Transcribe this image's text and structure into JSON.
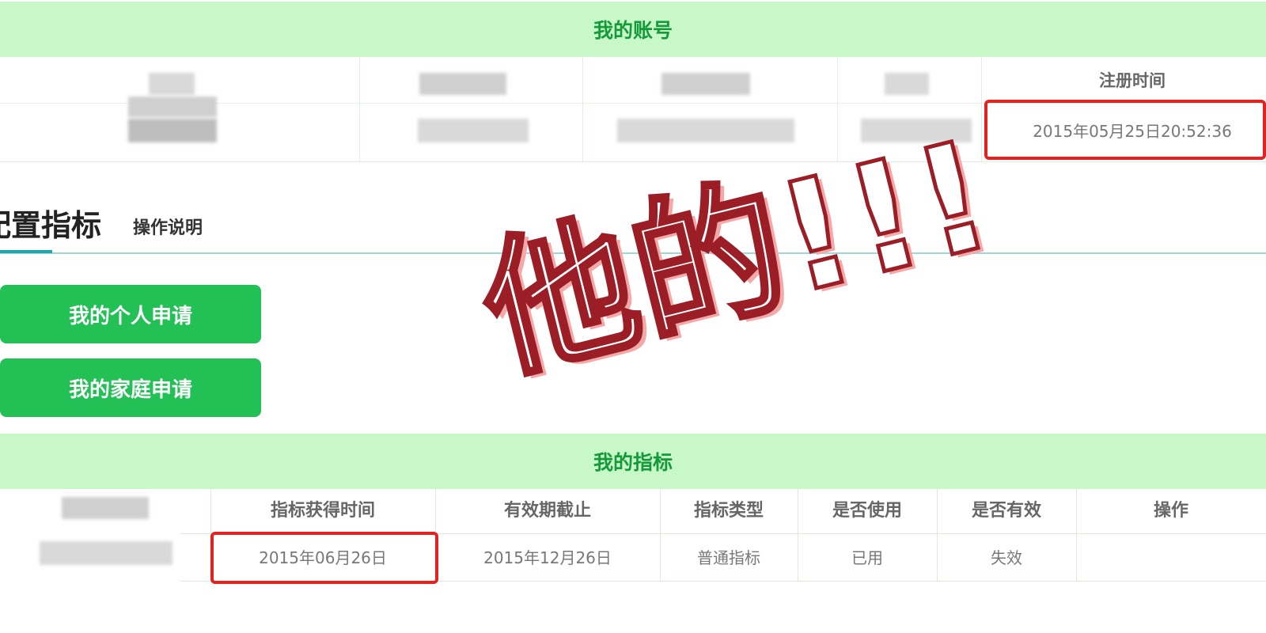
{
  "account_section": {
    "title": "我的账号",
    "register_time_header": "注册时间",
    "register_time_value": "2015年05月25日20:52:36"
  },
  "tabs": {
    "active_label": "配置指标",
    "inactive_label": "操作说明"
  },
  "buttons": {
    "personal": "我的个人申请",
    "family": "我的家庭申请"
  },
  "quota_section": {
    "title": "我的指标",
    "columns": [
      "指标获得时间",
      "有效期截止",
      "指标类型",
      "是否使用",
      "是否有效",
      "操作"
    ],
    "row": [
      "2015年06月26日",
      "2015年12月26日",
      "普通指标",
      "已用",
      "失效",
      ""
    ]
  },
  "watermark": {
    "text": "他的!!!"
  },
  "colors": {
    "section_bar": "#c8f7c8",
    "section_title": "#159a3a",
    "button_green": "#22c055",
    "highlight_red": "#e32222",
    "tab_accent": "#21a8a8",
    "watermark_stroke": "#9b1d25"
  }
}
